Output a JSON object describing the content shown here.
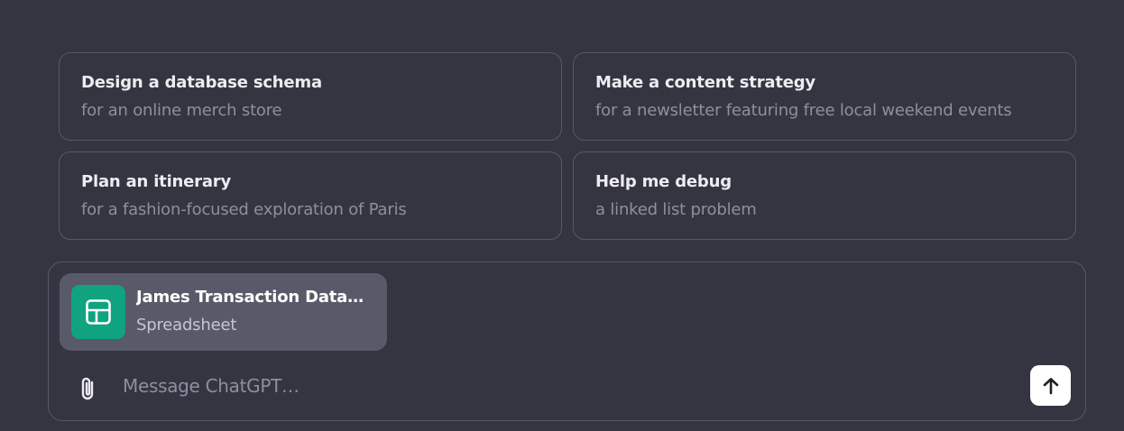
{
  "suggestions": [
    {
      "title": "Design a database schema",
      "subtitle": "for an online merch store"
    },
    {
      "title": "Make a content strategy",
      "subtitle": "for a newsletter featuring free local weekend events"
    },
    {
      "title": "Plan an itinerary",
      "subtitle": "for a fashion-focused exploration of Paris"
    },
    {
      "title": "Help me debug",
      "subtitle": "a linked list problem"
    }
  ],
  "composer": {
    "attachment": {
      "name": "James Transaction Datase...",
      "type": "Spreadsheet",
      "icon": "spreadsheet-icon",
      "icon_color": "#10a37f"
    },
    "placeholder": "Message ChatGPT…",
    "attach_icon": "paperclip-icon",
    "send_icon": "arrow-up-icon"
  }
}
